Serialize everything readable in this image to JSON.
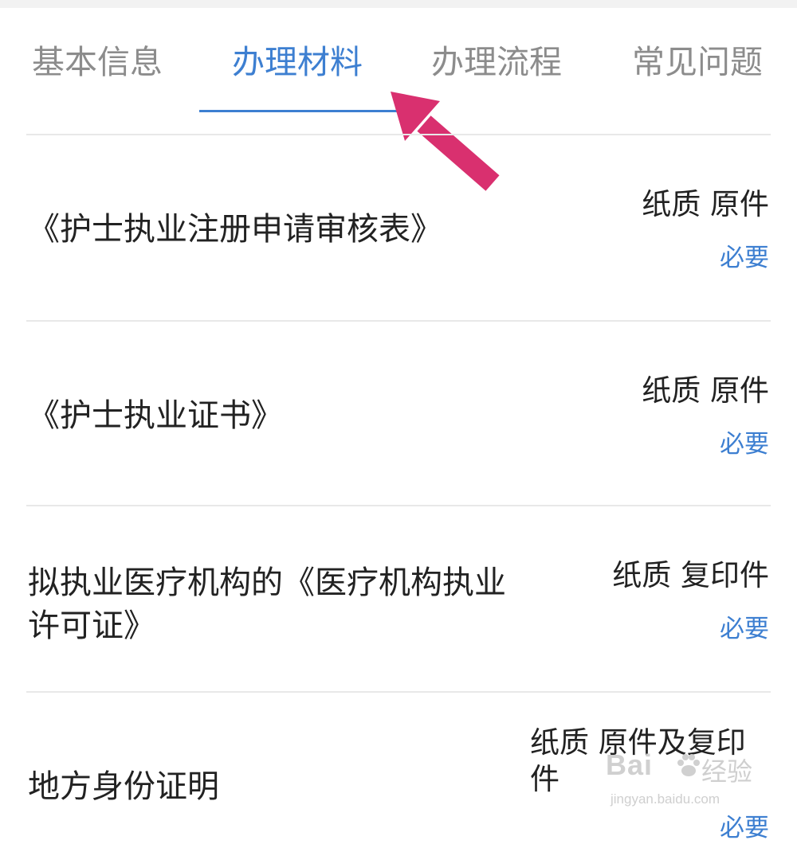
{
  "tabs": [
    {
      "label": "基本信息",
      "active": false
    },
    {
      "label": "办理材料",
      "active": true
    },
    {
      "label": "办理流程",
      "active": false
    },
    {
      "label": "常见问题",
      "active": false
    }
  ],
  "materials": [
    {
      "title_line1": "《护士执业注册申请审核表》",
      "title_line2": "",
      "type": "纸质 原件",
      "required": "必要"
    },
    {
      "title_line1": "《护士执业证书》",
      "title_line2": "",
      "type": "纸质 原件",
      "required": "必要"
    },
    {
      "title_line1": "拟执业医疗机构的《医疗机构执业",
      "title_line2": "许可证》",
      "type": "纸质 复印件",
      "required": "必要"
    },
    {
      "title_line1": "地方身份证明",
      "title_line2": "",
      "type_line1": "纸质 原件及复印",
      "type_line2": "件",
      "required": "必要"
    }
  ],
  "annotation": {
    "arrow_color": "#d9306f"
  },
  "watermark": {
    "brand": "Bai",
    "brand_end": "u",
    "cn": "经验",
    "url": "jingyan.baidu.com"
  },
  "colors": {
    "accent": "#3d7fd1",
    "inactive_tab": "#8c8c8c"
  }
}
